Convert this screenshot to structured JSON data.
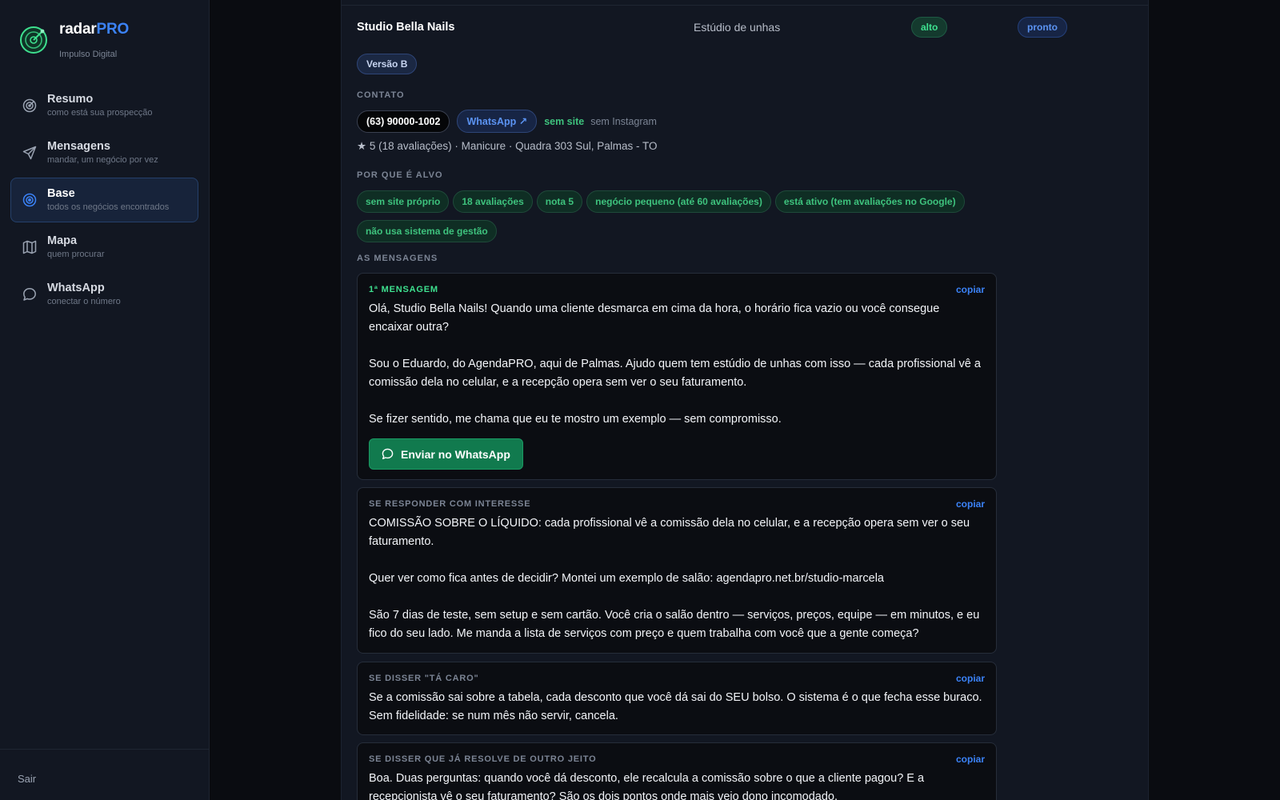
{
  "brand": {
    "name_main": "radar",
    "name_accent": "PRO",
    "subtitle": "Impulso Digital"
  },
  "nav": {
    "items": [
      {
        "label": "Resumo",
        "sub": "como está sua prospecção",
        "icon": "target-icon",
        "active": false
      },
      {
        "label": "Mensagens",
        "sub": "mandar, um negócio por vez",
        "icon": "send-icon",
        "active": false
      },
      {
        "label": "Base",
        "sub": "todos os negócios encontrados",
        "icon": "radar-icon",
        "active": true
      },
      {
        "label": "Mapa",
        "sub": "quem procurar",
        "icon": "map-icon",
        "active": false
      },
      {
        "label": "WhatsApp",
        "sub": "conectar o número",
        "icon": "chat-icon",
        "active": false
      }
    ],
    "logout": "Sair"
  },
  "business": {
    "name": "Studio Bella Nails",
    "category": "Estúdio de unhas",
    "priority": "alto",
    "status": "pronto",
    "version": "Versão B"
  },
  "contact": {
    "label": "CONTATO",
    "phone": "(63) 90000-1002",
    "whatsapp": "WhatsApp ↗",
    "site": "sem site",
    "instagram": "sem Instagram",
    "details": "★ 5 (18 avaliações) · Manicure · Quadra 303 Sul, Palmas - TO"
  },
  "reasons": {
    "label": "POR QUE É ALVO",
    "tags": [
      "sem site próprio",
      "18 avaliações",
      "nota 5",
      "negócio pequeno (até 60 avaliações)",
      "está ativo (tem avaliações no Google)",
      "não usa sistema de gestão"
    ]
  },
  "messages": {
    "label": "AS MENSAGENS",
    "copy_label": "copiar",
    "send_label": "Enviar no WhatsApp",
    "items": [
      {
        "title": "1ª MENSAGEM",
        "paragraphs": [
          "Olá, Studio Bella Nails! Quando uma cliente desmarca em cima da hora, o horário fica vazio ou você consegue encaixar outra?",
          "Sou o Eduardo, do AgendaPRO, aqui de Palmas. Ajudo quem tem estúdio de unhas com isso — cada profissional vê a comissão dela no celular, e a recepção opera sem ver o seu faturamento.",
          "Se fizer sentido, me chama que eu te mostro um exemplo — sem compromisso."
        ]
      },
      {
        "title": "SE RESPONDER COM INTERESSE",
        "paragraphs": [
          "COMISSÃO SOBRE O LÍQUIDO: cada profissional vê a comissão dela no celular, e a recepção opera sem ver o seu faturamento.",
          "Quer ver como fica antes de decidir? Montei um exemplo de salão: agendapro.net.br/studio-marcela",
          "São 7 dias de teste, sem setup e sem cartão. Você cria o salão dentro — serviços, preços, equipe — em minutos, e eu fico do seu lado. Me manda a lista de serviços com preço e quem trabalha com você que a gente começa?"
        ]
      },
      {
        "title": "SE DISSER \"TÁ CARO\"",
        "paragraphs": [
          "Se a comissão sai sobre a tabela, cada desconto que você dá sai do SEU bolso. O sistema é o que fecha esse buraco. Sem fidelidade: se num mês não servir, cancela."
        ]
      },
      {
        "title": "SE DISSER QUE JÁ RESOLVE DE OUTRO JEITO",
        "paragraphs": [
          "Boa. Duas perguntas: quando você dá desconto, ele recalcula a comissão sobre o que a cliente pagou? E a recepcionista vê o seu faturamento? São os dois pontos onde mais vejo dono incomodado."
        ]
      }
    ]
  }
}
